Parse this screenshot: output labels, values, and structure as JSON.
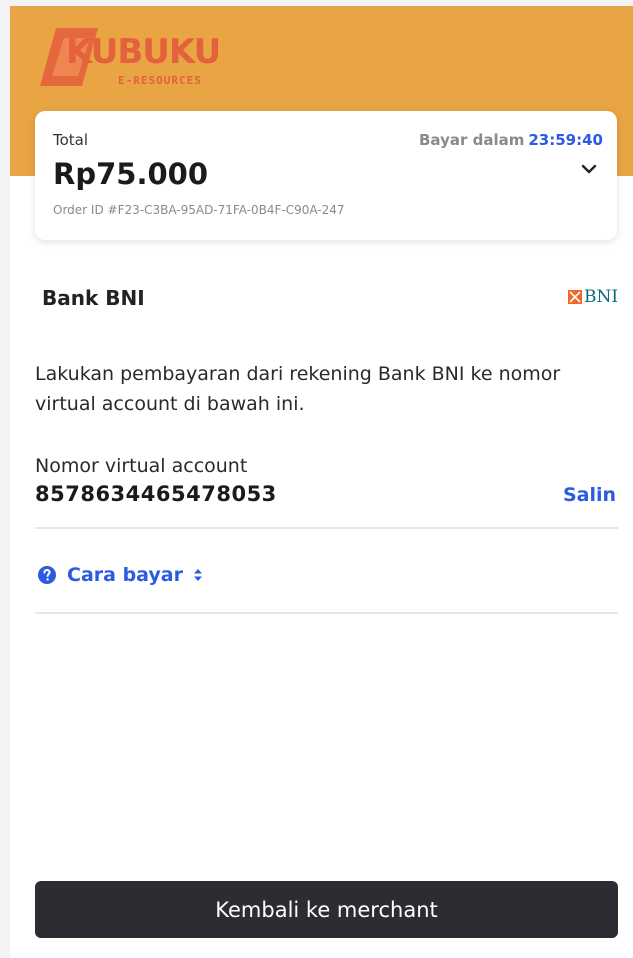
{
  "brand": {
    "logo_text": "KUBUKU",
    "logo_subtitle": "E-RESOURCES",
    "header_color": "#e9a543"
  },
  "summary": {
    "total_label": "Total",
    "amount": "Rp75.000",
    "pay_within_label": "Bayar dalam",
    "countdown": "23:59:40",
    "order_id": "Order ID #F23-C3BA-95AD-71FA-0B4F-C90A-247",
    "expand_icon": "chevron-down-icon"
  },
  "bank": {
    "name": "Bank BNI",
    "logo_text": "BNI"
  },
  "instructions": "Lakukan pembayaran dari rekening Bank BNI ke nomor virtual account di bawah ini.",
  "virtual_account": {
    "label": "Nomor virtual account",
    "number": "8578634465478053",
    "copy_label": "Salin"
  },
  "how_to_pay": {
    "label": "Cara bayar",
    "icon": "help-icon",
    "toggle_icon": "sort-icon"
  },
  "footer": {
    "back_button_label": "Kembali ke merchant"
  },
  "colors": {
    "accent_blue": "#2c5ae0",
    "button_dark": "#2b2d33",
    "logo_orange": "#e4613d"
  }
}
